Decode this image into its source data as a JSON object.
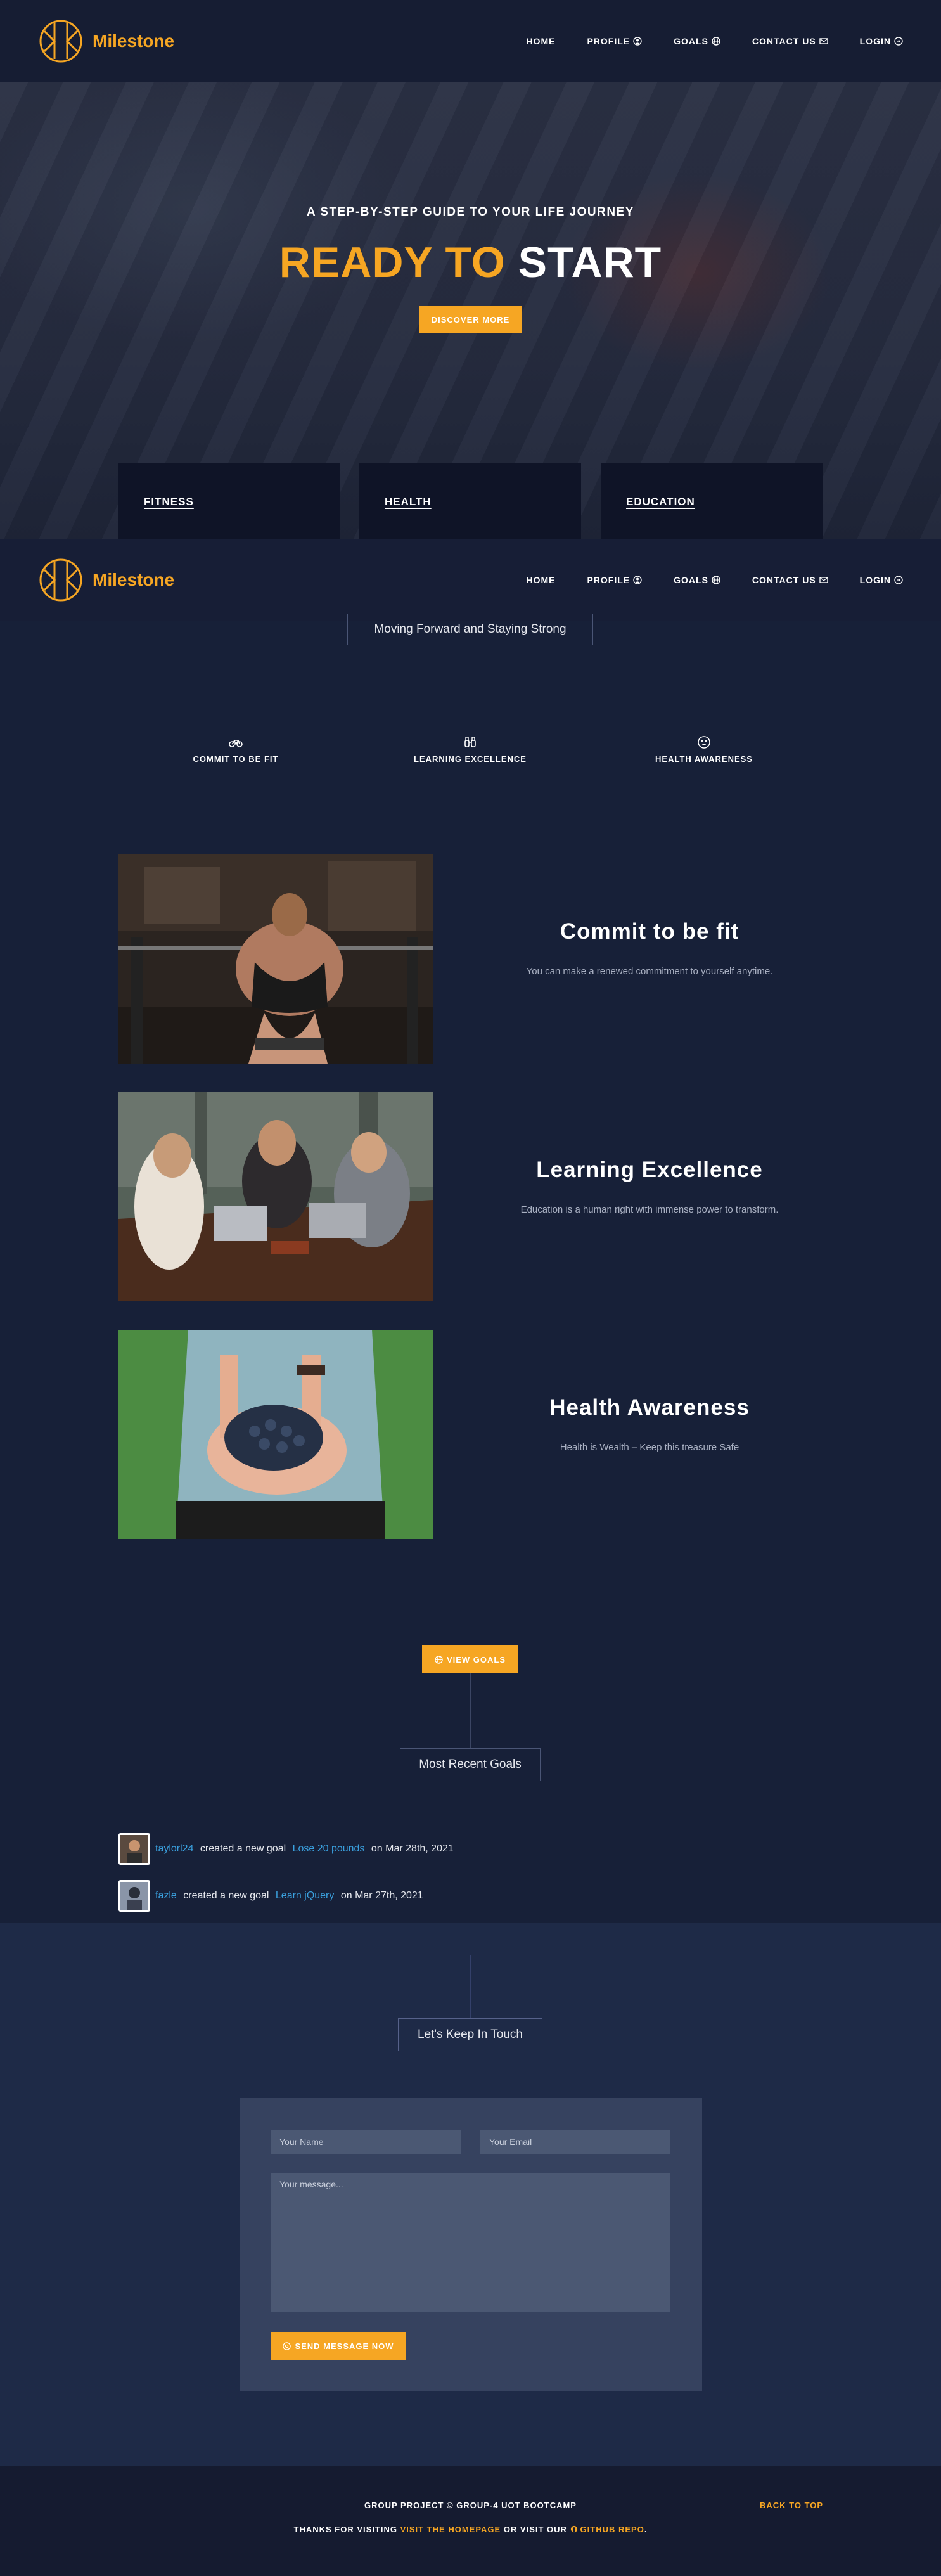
{
  "brand": {
    "name": "Milestone"
  },
  "nav": {
    "items": [
      {
        "label": "HOME",
        "icon": ""
      },
      {
        "label": "PROFILE",
        "icon": "user-circle-icon"
      },
      {
        "label": "GOALS",
        "icon": "globe-icon"
      },
      {
        "label": "CONTACT US",
        "icon": "envelope-icon"
      },
      {
        "label": "LOGIN",
        "icon": "login-icon"
      }
    ]
  },
  "hero": {
    "subtitle": "A STEP-BY-STEP GUIDE TO YOUR LIFE JOURNEY",
    "title_accent": "READY TO",
    "title_rest": " START",
    "button": "DISCOVER MORE"
  },
  "categories": [
    "FITNESS",
    "HEALTH",
    "EDUCATION"
  ],
  "intro": {
    "label": "Moving Forward and Staying Strong"
  },
  "features": [
    {
      "label": "COMMIT TO BE FIT",
      "icon": "bicycle-icon"
    },
    {
      "label": "LEARNING EXCELLENCE",
      "icon": "binoculars-icon"
    },
    {
      "label": "HEALTH AWARENESS",
      "icon": "smile-icon"
    }
  ],
  "blocks": [
    {
      "title": "Commit to be fit",
      "text": "You can make a renewed commitment to yourself anytime.",
      "image": "gym-weightlifting-photo"
    },
    {
      "title": "Learning Excellence",
      "text": "Education is a human right with immense power to transform.",
      "image": "students-laptops-photo"
    },
    {
      "title": "Health Awareness",
      "text": "Health is Wealth – Keep this treasure Safe",
      "image": "blueberries-hands-photo"
    }
  ],
  "goals_section": {
    "button": "VIEW GOALS",
    "label": "Most Recent Goals",
    "items": [
      {
        "user": "taylorl24",
        "mid": " created a new goal ",
        "goal": "Lose 20 pounds",
        "date": " on Mar 28th, 2021"
      },
      {
        "user": "fazle",
        "mid": " created a new goal ",
        "goal": "Learn jQuery",
        "date": " on Mar 27th, 2021"
      }
    ]
  },
  "contact": {
    "label": "Let's Keep In Touch",
    "name_placeholder": "Your Name",
    "email_placeholder": "Your Email",
    "message_placeholder": "Your message...",
    "send_button": "SEND MESSAGE NOW"
  },
  "footer": {
    "line1": "GROUP PROJECT © GROUP-4 UOT BOOTCAMP",
    "line2_pre": "THANKS FOR VISITING ",
    "line2_link1": "VISIT THE HOMEPAGE",
    "line2_mid": " OR VISIT OUR ",
    "line2_link2": "GITHUB REPO",
    "line2_end": ".",
    "back_to_top": "BACK TO TOP"
  },
  "colors": {
    "accent": "#f6a623",
    "background": "#172038",
    "link": "#3aa0de"
  }
}
